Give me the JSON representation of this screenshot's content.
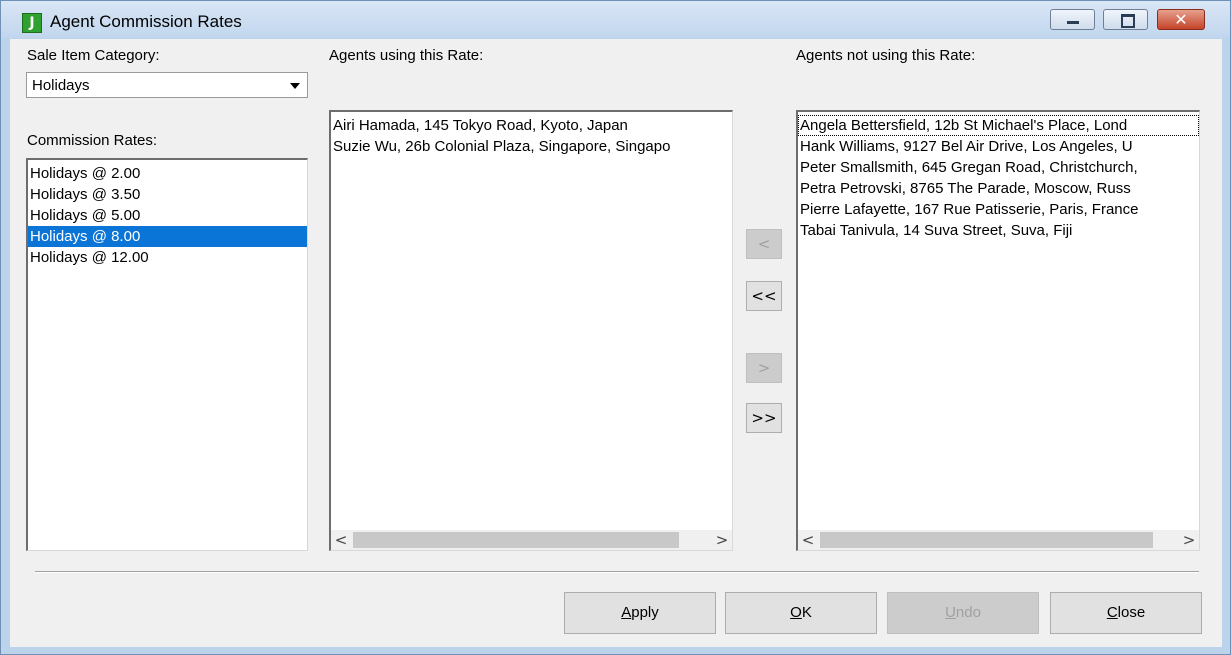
{
  "window": {
    "title": "Agent Commission Rates",
    "app_icon_letter": "J",
    "controls": {
      "minimize": "▬",
      "maximize": "□",
      "close": "✕"
    }
  },
  "sale_item": {
    "label": "Sale Item Category:",
    "value": "Holidays"
  },
  "commission_rates": {
    "label": "Commission Rates:",
    "items": [
      "Holidays @ 2.00",
      "Holidays @ 3.50",
      "Holidays @ 5.00",
      "Holidays @ 8.00",
      "Holidays @ 12.00"
    ],
    "selected_index": 3
  },
  "agents_using": {
    "label": "Agents using this Rate:",
    "items": [
      "Airi Hamada, 145 Tokyo Road, Kyoto, Japan",
      "Suzie Wu, 26b Colonial Plaza, Singapore, Singapo"
    ]
  },
  "agents_not_using": {
    "label": "Agents not using this Rate:",
    "items": [
      "Angela Bettersfield, 12b St Michael's Place, Lond",
      "Hank Williams, 9127 Bel Air Drive, Los Angeles, U",
      "Peter Smallsmith, 645 Gregan Road, Christchurch,",
      "Petra Petrovski, 8765 The Parade, Moscow, Russ",
      "Pierre Lafayette, 167 Rue Patisserie, Paris, France",
      "Tabai Tanivula, 14 Suva Street, Suva, Fiji"
    ]
  },
  "transfer_buttons": {
    "remove_one": "<",
    "remove_all": "<<",
    "add_one": ">",
    "add_all": ">>"
  },
  "scroll_arrows": {
    "left": "<",
    "right": ">"
  },
  "footer_buttons": {
    "apply": {
      "mnemonic": "A",
      "rest": "pply"
    },
    "ok": {
      "mnemonic": "O",
      "rest": "K"
    },
    "undo": {
      "mnemonic": "U",
      "rest": "ndo"
    },
    "close": {
      "mnemonic": "C",
      "rest": "lose"
    }
  }
}
